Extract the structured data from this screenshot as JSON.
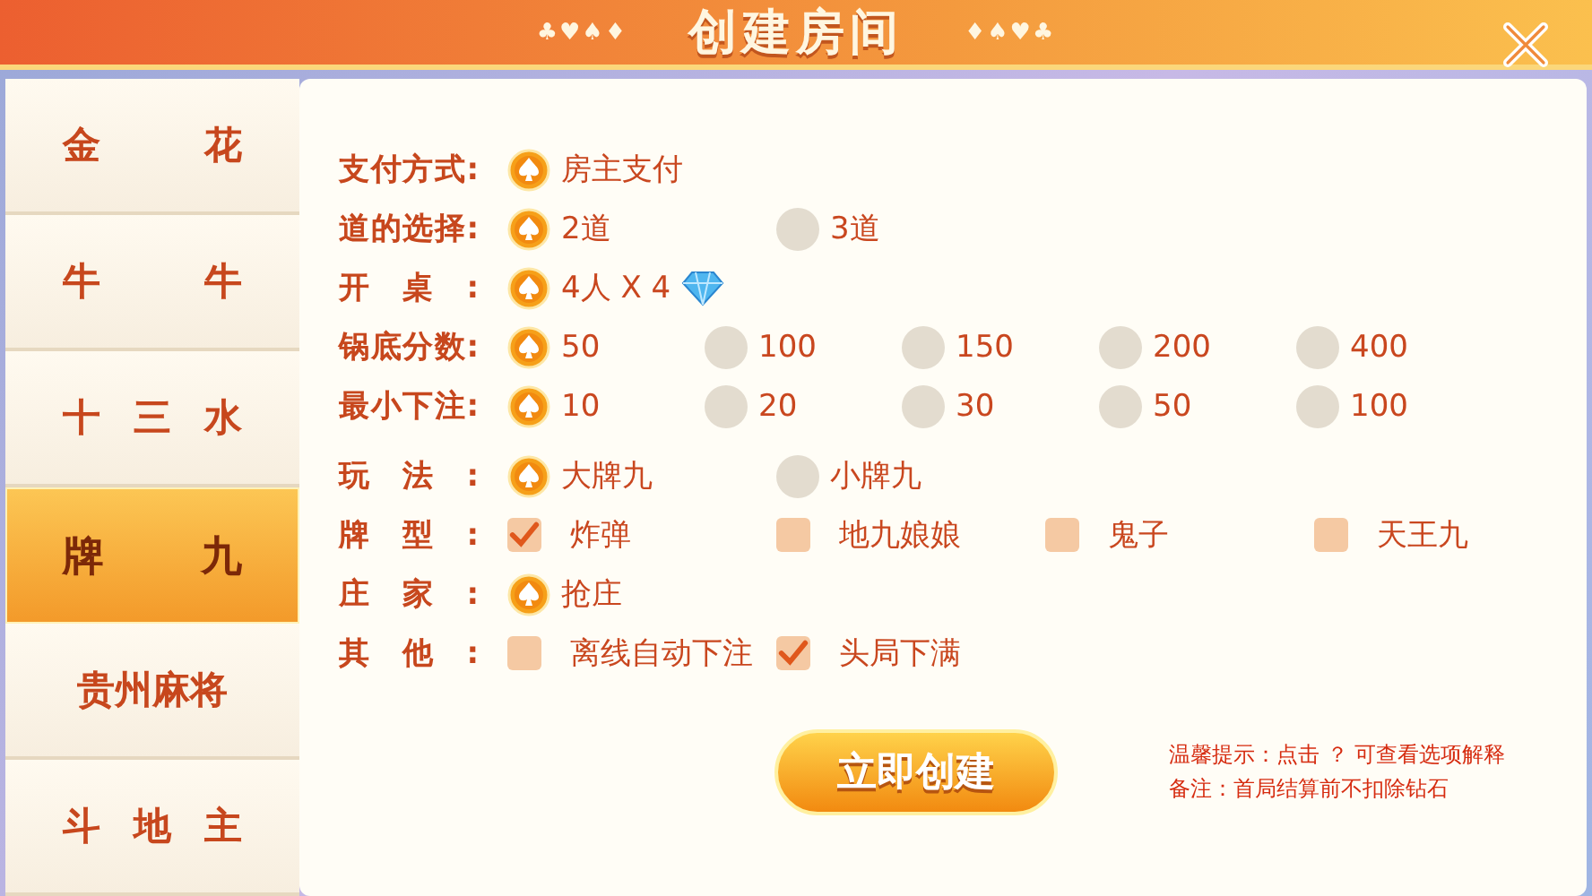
{
  "header": {
    "title": "创建房间",
    "ornament_left": "♣♥♠♦",
    "ornament_right": "♦♠♥♣"
  },
  "sidebar": {
    "items": [
      {
        "label": "金花",
        "selected": false
      },
      {
        "label": "牛牛",
        "selected": false
      },
      {
        "label": "十三水",
        "selected": false
      },
      {
        "label": "牌九",
        "selected": true
      },
      {
        "label": "贵州麻将",
        "selected": false
      },
      {
        "label": "斗地主",
        "selected": false
      }
    ]
  },
  "options": [
    {
      "label": "支付方式:",
      "kind": "radio",
      "choices": [
        {
          "text": "房主支付",
          "selected": true
        }
      ]
    },
    {
      "label": "道的选择:",
      "kind": "radio",
      "choices": [
        {
          "text": "2道",
          "selected": true
        },
        {
          "text": "3道",
          "selected": false
        }
      ]
    },
    {
      "label": "开桌:",
      "kind": "radio",
      "choices": [
        {
          "text": "4人 X 4",
          "selected": true,
          "diamond": true
        }
      ]
    },
    {
      "label": "锅底分数:",
      "kind": "radio",
      "choices": [
        {
          "text": "50",
          "selected": true
        },
        {
          "text": "100",
          "selected": false
        },
        {
          "text": "150",
          "selected": false
        },
        {
          "text": "200",
          "selected": false
        },
        {
          "text": "400",
          "selected": false
        }
      ]
    },
    {
      "label": "最小下注:",
      "kind": "radio",
      "choices": [
        {
          "text": "10",
          "selected": true
        },
        {
          "text": "20",
          "selected": false
        },
        {
          "text": "30",
          "selected": false
        },
        {
          "text": "50",
          "selected": false
        },
        {
          "text": "100",
          "selected": false
        }
      ]
    },
    {
      "label": "玩法:",
      "kind": "radio",
      "choices": [
        {
          "text": "大牌九",
          "selected": true
        },
        {
          "text": "小牌九",
          "selected": false
        }
      ]
    },
    {
      "label": "牌型:",
      "kind": "checkbox",
      "choices": [
        {
          "text": "炸弹",
          "selected": true
        },
        {
          "text": "地九娘娘",
          "selected": false
        },
        {
          "text": "鬼子",
          "selected": false
        },
        {
          "text": "天王九",
          "selected": false
        }
      ]
    },
    {
      "label": "庄家:",
      "kind": "radio",
      "choices": [
        {
          "text": "抢庄",
          "selected": true
        }
      ]
    },
    {
      "label": "其他:",
      "kind": "checkbox",
      "choices": [
        {
          "text": "离线自动下注",
          "selected": false
        },
        {
          "text": "头局下满",
          "selected": true
        }
      ]
    }
  ],
  "create_button": "立即创建",
  "notes": [
    "温馨提示：点击 ？ 可查看选项解释",
    "备注：首局结算前不扣除钻石"
  ]
}
